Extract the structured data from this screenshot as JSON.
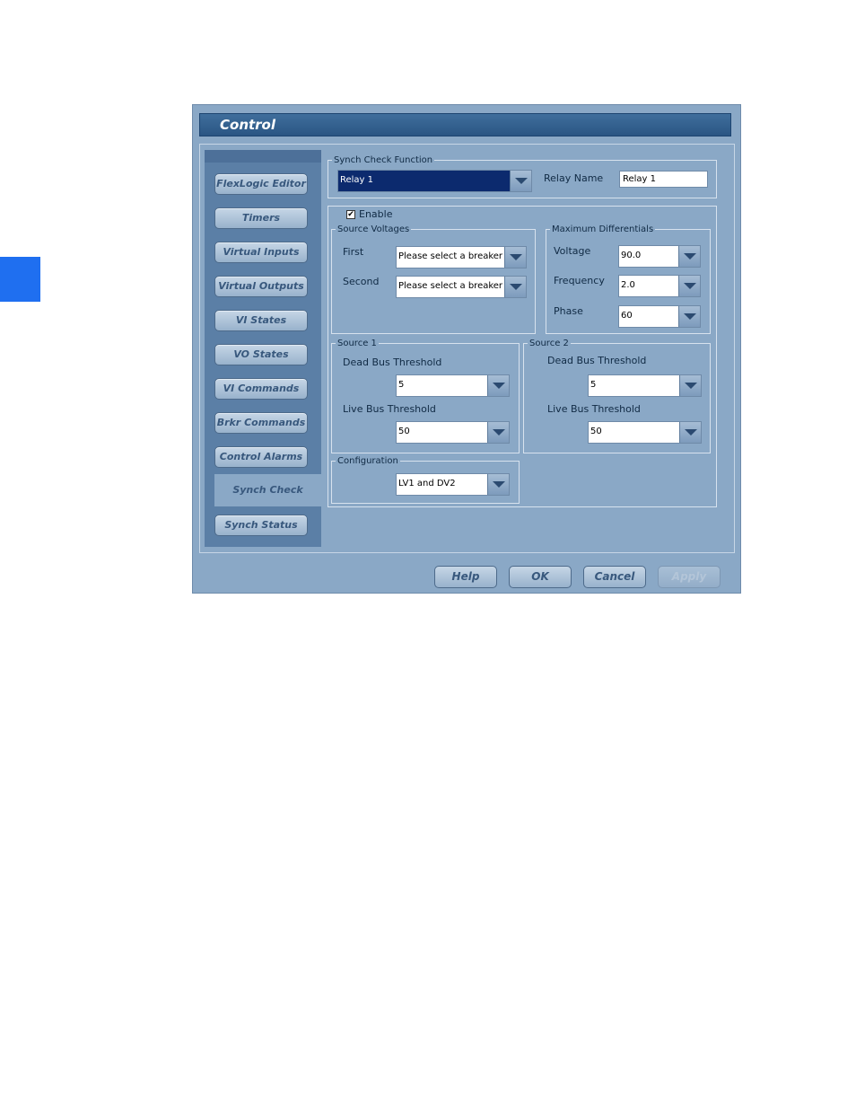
{
  "window": {
    "title": "Control"
  },
  "nav": {
    "items": [
      {
        "label": "FlexLogic Editor"
      },
      {
        "label": "Timers"
      },
      {
        "label": "Virtual Inputs"
      },
      {
        "label": "Virtual Outputs"
      },
      {
        "label": "VI States"
      },
      {
        "label": "VO States"
      },
      {
        "label": "VI Commands"
      },
      {
        "label": "Brkr Commands"
      },
      {
        "label": "Control Alarms"
      },
      {
        "label": "Synch Check",
        "selected": true
      },
      {
        "label": "Synch Status"
      }
    ]
  },
  "synch_check": {
    "legend": "Synch Check Function",
    "function_value": "Relay 1",
    "relay_name_label": "Relay Name",
    "relay_name_value": "Relay 1"
  },
  "enable": {
    "label": "Enable",
    "checked": true,
    "mark": "✔"
  },
  "source_voltages": {
    "legend": "Source Voltages",
    "first_label": "First",
    "first_value": "Please select a breaker",
    "second_label": "Second",
    "second_value": "Please select a breaker"
  },
  "max_diff": {
    "legend": "Maximum Differentials",
    "voltage_label": "Voltage",
    "voltage_value": "90.0",
    "frequency_label": "Frequency",
    "frequency_value": "2.0",
    "phase_label": "Phase",
    "phase_value": "60"
  },
  "source1": {
    "legend": "Source 1",
    "dead_label": "Dead Bus Threshold",
    "dead_value": "5",
    "live_label": "Live Bus Threshold",
    "live_value": "50"
  },
  "source2": {
    "legend": "Source 2",
    "dead_label": "Dead Bus Threshold",
    "dead_value": "5",
    "live_label": "Live Bus Threshold",
    "live_value": "50"
  },
  "configuration": {
    "legend": "Configuration",
    "value": "LV1 and DV2"
  },
  "footer": {
    "help": "Help",
    "ok": "OK",
    "cancel": "Cancel",
    "apply": "Apply"
  }
}
